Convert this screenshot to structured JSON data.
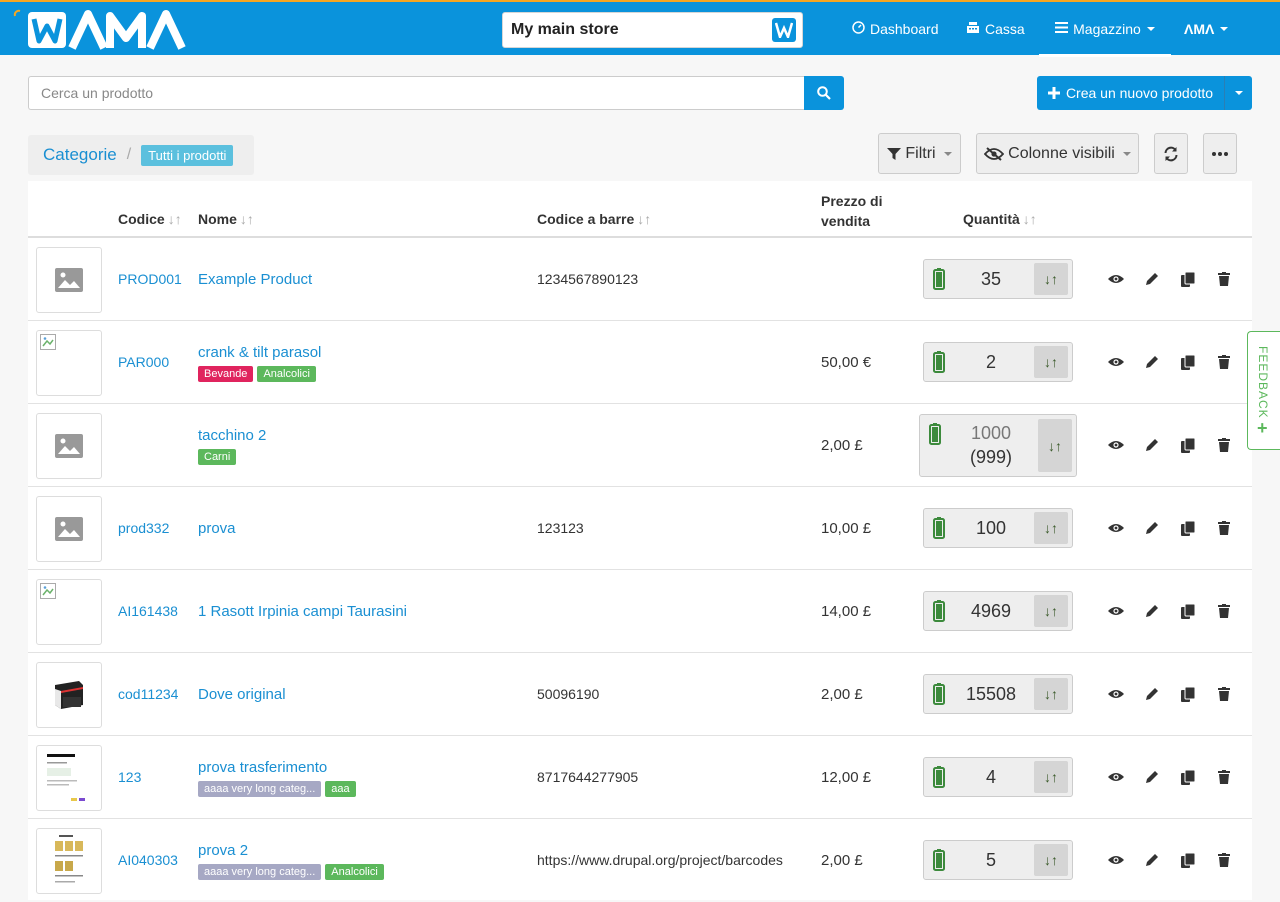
{
  "header": {
    "store_name": "My main store",
    "nav": {
      "dashboard": "Dashboard",
      "cassa": "Cassa",
      "magazzino": "Magazzino",
      "user": "ɅMɅ"
    }
  },
  "search": {
    "placeholder": "Cerca un prodotto"
  },
  "create_button": "Crea un nuovo prodotto",
  "breadcrumb": {
    "root": "Categorie",
    "current": "Tutti i prodotti"
  },
  "toolbar": {
    "filters": "Filtri",
    "visible_columns": "Colonne visibili"
  },
  "columns": {
    "code": "Codice",
    "name": "Nome",
    "barcode": "Codice a barre",
    "price_line1": "Prezzo di",
    "price_line2": "vendita",
    "quantity": "Quantità"
  },
  "rows": [
    {
      "code": "PROD001",
      "name": "Example Product",
      "barcode": "1234567890123",
      "price": "",
      "quantity": "35",
      "tags": []
    },
    {
      "code": "PAR000",
      "name": "crank & tilt parasol",
      "barcode": "",
      "price": "50,00 €",
      "quantity": "2",
      "tags": [
        "Bevande",
        "Analcolici"
      ]
    },
    {
      "code": "",
      "name": "tacchino 2",
      "barcode": "",
      "price": "2,00 £",
      "quantity": "1000",
      "quantity_sub": "(999)",
      "tags": [
        "Carni"
      ]
    },
    {
      "code": "prod332",
      "name": "prova",
      "barcode": "123123",
      "price": "10,00 £",
      "quantity": "100",
      "tags": []
    },
    {
      "code": "AI161438",
      "name": "1 Rasott Irpinia campi Taurasini",
      "barcode": "",
      "price": "14,00 £",
      "quantity": "4969",
      "tags": []
    },
    {
      "code": "cod11234",
      "name": "Dove original",
      "barcode": "50096190",
      "price": "2,00 £",
      "quantity": "15508",
      "tags": []
    },
    {
      "code": "123",
      "name": "prova trasferimento",
      "barcode": "8717644277905",
      "price": "12,00 £",
      "quantity": "4",
      "tags": [
        "aaaa very long categ...",
        "aaa"
      ]
    },
    {
      "code": "AI040303",
      "name": "prova 2",
      "barcode": "https://www.drupal.org/project/barcodes",
      "price": "2,00 £",
      "quantity": "5",
      "tags": [
        "aaaa very long categ...",
        "Analcolici"
      ]
    }
  ],
  "feedback": "FEEDBACK",
  "colors": {
    "brand": "#0a93dc",
    "link": "#1a8fd2",
    "tag_red": "#e0245e",
    "tag_green": "#5cb85c",
    "tag_grey": "#a6a8c4",
    "battery": "#3c8a3c"
  }
}
